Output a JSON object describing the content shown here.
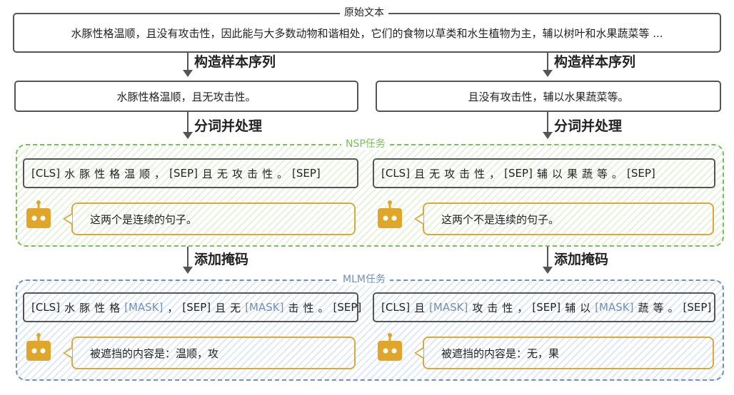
{
  "source": {
    "label": "原始文本",
    "text": "水豚性格温顺，且没有攻击性，因此能与大多数动物和谐相处，它们的食物以草类和水生植物为主，辅以树叶和水果蔬菜等 ..."
  },
  "steps": {
    "build_sample": "构造样本序列",
    "tokenize": "分词并处理",
    "add_mask": "添加掩码"
  },
  "samples": {
    "left": "水豚性格温顺，且无攻击性。",
    "right": "且没有攻击性，辅以水果蔬菜等。"
  },
  "nsp": {
    "label": "NSP任务",
    "left_tokens": [
      "[CLS]",
      "水",
      "豚",
      "性",
      "格",
      "温",
      "顺",
      "，",
      "[SEP]",
      "且",
      "无",
      "攻",
      "击",
      "性",
      "。",
      "[SEP]"
    ],
    "right_tokens": [
      "[CLS]",
      "且",
      "无",
      "攻",
      "击",
      "性",
      "，",
      "[SEP]",
      "辅",
      "以",
      "果",
      "蔬",
      "等",
      "。",
      "[SEP]"
    ],
    "left_result": "这两个是连续的句子。",
    "right_result": "这两个不是连续的句子。"
  },
  "mlm": {
    "label": "MLM任务",
    "left_tokens": [
      "[CLS]",
      "水",
      "豚",
      "性",
      "格",
      "[MASK]",
      "，",
      "[SEP]",
      "且",
      "无",
      "[MASK]",
      "击",
      "性",
      "。",
      "[SEP]"
    ],
    "right_tokens": [
      "[CLS]",
      "且",
      "[MASK]",
      "攻",
      "击",
      "性",
      "，",
      "[SEP]",
      "辅",
      "以",
      "[MASK]",
      "蔬",
      "等",
      "。",
      "[SEP]"
    ],
    "left_result": "被遮挡的内容是：温顺，攻",
    "right_result": "被遮挡的内容是：无，果"
  },
  "colors": {
    "nsp": "#7bbd5e",
    "mlm": "#6f8fbf",
    "robot": "#e0a62a",
    "mask_text": "#6f8fbf"
  },
  "icons": [
    "robot-icon"
  ]
}
